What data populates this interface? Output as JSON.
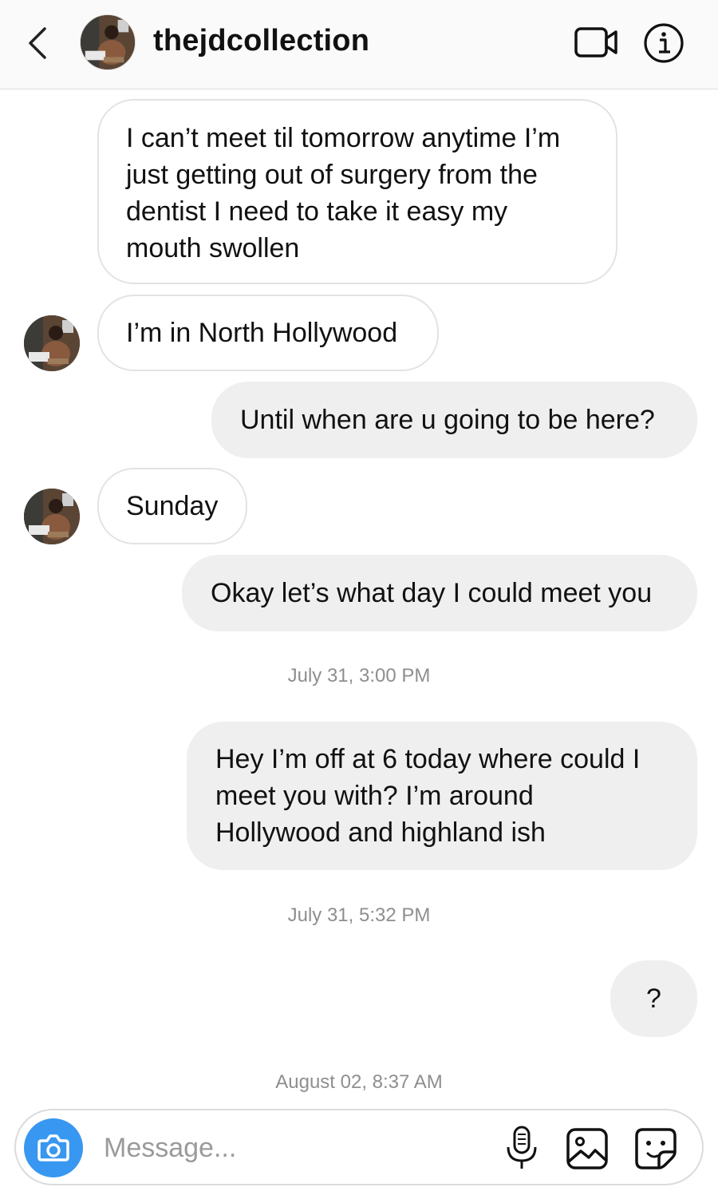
{
  "header": {
    "username": "thejdcollection",
    "back_icon": "chevron-left-icon",
    "video_icon": "video-camera-icon",
    "info_icon": "info-icon"
  },
  "messages": [
    {
      "from": "them",
      "lines": [
        "I can’t meet til tomorrow anytime I’m",
        "just getting out of surgery from the",
        "dentist I need to take it easy my",
        "mouth swollen"
      ]
    },
    {
      "from": "them",
      "lines": [
        "I’m in North Hollywood"
      ]
    },
    {
      "from": "me",
      "lines": [
        "Until when are u going to be here?"
      ]
    },
    {
      "from": "them",
      "lines": [
        "Sunday"
      ]
    },
    {
      "from": "me",
      "lines": [
        "Okay let’s what day I could meet you"
      ]
    },
    {
      "from": "me",
      "lines": [
        "Hey I’m off at 6 today where could I",
        "meet you with? I’m around",
        "Hollywood and highland ish"
      ]
    },
    {
      "from": "me",
      "lines": [
        "?"
      ]
    }
  ],
  "timestamps": [
    "July 31, 3:00 PM",
    "July 31, 5:32 PM",
    "August 02, 8:37 AM"
  ],
  "composer": {
    "placeholder": "Message...",
    "camera_icon": "camera-icon",
    "mic_icon": "microphone-icon",
    "gallery_icon": "gallery-icon",
    "sticker_icon": "sticker-icon"
  },
  "colors": {
    "accent": "#3897f0",
    "outgoing_bubble": "#efefef",
    "incoming_border": "#e3e3e3",
    "timestamp": "#8e8e8e"
  }
}
